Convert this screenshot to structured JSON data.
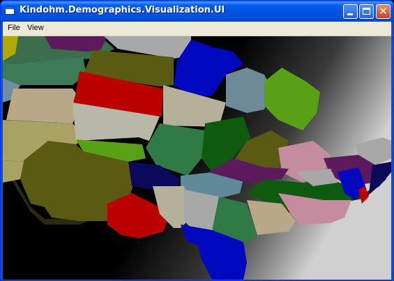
{
  "window": {
    "title": "Kindohm.Demographics.Visualization.UI",
    "buttons": [
      "minimize",
      "maximize",
      "close"
    ],
    "close_glyph": "✕"
  },
  "menu": {
    "items": [
      {
        "label": "File"
      },
      {
        "label": "View"
      }
    ]
  },
  "viewport": {
    "content": "3d-state-map",
    "background_colors": [
      "#000000",
      "#5a5a5a",
      "#cfcfcf"
    ]
  },
  "colors": {
    "titlebar": "#0054e3",
    "close_button": "#c6421c",
    "menubar": "#ece9d8"
  }
}
